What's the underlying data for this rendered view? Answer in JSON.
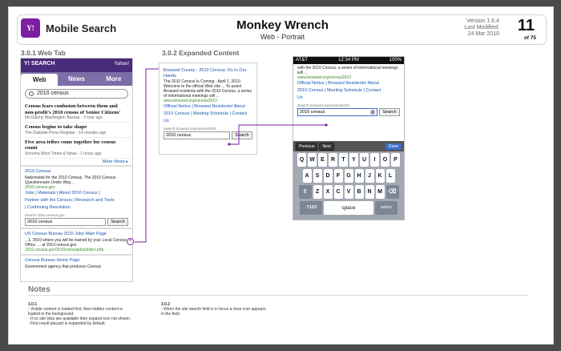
{
  "header": {
    "app_title": "Mobile Search",
    "page_title": "Monkey Wrench",
    "page_subtitle": "Web - Portrait",
    "version": "Version 1.6.4",
    "last_modified_label": "Last Modified:",
    "date": "24 Mar 2010",
    "page_number": "11",
    "page_of": "of 75",
    "logo_letter": "Y",
    "logo_mark": "!"
  },
  "sections": {
    "s1": "3.0.1  Web Tab",
    "s2": "3.0.2  Expanded Content"
  },
  "phone1": {
    "brand": "Y! SEARCH",
    "brand_right": "Yahoo!",
    "tabs": [
      "Web",
      "News",
      "More"
    ],
    "query": "2010 census",
    "news": [
      {
        "headline": "Census fears confusion between them and non-profit's 2010 census of Senior Citizens'",
        "source": "McClatchy Washington Bureau - 1 hour ago"
      },
      {
        "headline": "Census begins to take shape",
        "source": "The Oakdale Press Register - 14 minutes ago"
      },
      {
        "headline": "Five area tribes come together for census count",
        "source": "Sonoma West Times & News - 1 hours ago"
      }
    ],
    "more_news": "More News ▸",
    "result1": {
      "title": "2010 Census",
      "snippet": "Nationwide for the 2010 Census. The 2010 Census Questionnaire Under Way...",
      "url": "2010.census.gov"
    },
    "sitelinks": [
      "Jobs | Materials | About 2010 Census |",
      "Partner with the Census | Research and Tools",
      "| Continuing Resolution"
    ],
    "site_search_label": "Search 2010.census.gov",
    "site_search_value": "2010 census",
    "search_btn": "Search",
    "result2": {
      "title": "US Census Bureau 2010 Jobs Main Page",
      "snippet": "...1, 2010 where you will be trained by your Local Census Office. ... at 2010.census.gov",
      "url": "2010.census.gov/2010censusjobs/index.php"
    },
    "result3": {
      "title": "Census Bureau Home Page",
      "snippet": "Government agency that produces Census"
    },
    "expand_icon": "+"
  },
  "panel2": {
    "title": "Broward County - 2010 Census: It's In Our Hands",
    "snippet": "The 2010 Census Is Coming - April 1, 2010. Welcome to the official Web site ... To assist Broward residents with the 2010 Census, a series of informational meetings will ...",
    "url": "www.broward.org/census2010",
    "links": [
      "Official Notice | Broward Residents! About",
      "2010 Census | Meeting Schedule | Contact",
      "Us"
    ],
    "site_search_label": "Search broward.org/census2010",
    "site_search_value": "2010 census",
    "search_btn": "Search"
  },
  "phone3": {
    "status_left": "AT&T",
    "clock": "12:34 PM",
    "status_right": "100%",
    "top_snippet": "with the 2010 Census, a series of informational meetings will ...",
    "url": "www.broward.org/census2010",
    "links": [
      "Official Notice | Broward Residents! About",
      "2010 Census | Meeting Schedule | Contact",
      "Us"
    ],
    "site_search_label": "Search broward.org/census2010",
    "site_search_value": "2010 census",
    "search_btn": "Search",
    "kb_prev": "Previous",
    "kb_next": "Next",
    "kb_done": "Done",
    "row1": [
      "Q",
      "W",
      "E",
      "R",
      "T",
      "Y",
      "U",
      "I",
      "O",
      "P"
    ],
    "row2": [
      "A",
      "S",
      "D",
      "F",
      "G",
      "H",
      "J",
      "K",
      "L"
    ],
    "row3": [
      "Z",
      "X",
      "C",
      "V",
      "B",
      "N",
      "M"
    ],
    "key_shift": "⇧",
    "key_delete": "⌫",
    "key_num": ".?123",
    "key_space": "space",
    "key_return": "return"
  },
  "notes": {
    "title": "Notes",
    "n1_id": "3.0.1",
    "n1": [
      "- Visible content is loaded first, then hidden content is",
      "loaded in the background.",
      "- If no site links are available then expand icon not shown.",
      "- First result placard is expanded by default."
    ],
    "n2_id": "3.0.2",
    "n2": [
      "- When the site search field is in focus a clear icon appears",
      "in the field."
    ]
  },
  "colors": {
    "yahoo_purple": "#7b1fa2",
    "link": "#1a55b0",
    "connector": "#7b1fa2"
  }
}
